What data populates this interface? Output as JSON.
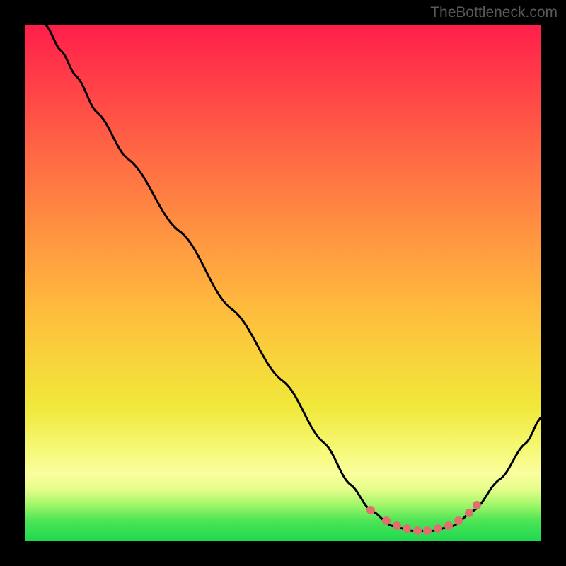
{
  "watermark": "TheBottleneck.com",
  "chart_data": {
    "type": "line",
    "title": "",
    "xlabel": "",
    "ylabel": "",
    "xlim": [
      0,
      100
    ],
    "ylim": [
      0,
      100
    ],
    "curve": {
      "name": "bottleneck-curve",
      "points": [
        {
          "x": 4,
          "y": 100
        },
        {
          "x": 7,
          "y": 95
        },
        {
          "x": 10,
          "y": 90
        },
        {
          "x": 14,
          "y": 83
        },
        {
          "x": 20,
          "y": 74
        },
        {
          "x": 30,
          "y": 60
        },
        {
          "x": 40,
          "y": 45
        },
        {
          "x": 50,
          "y": 31
        },
        {
          "x": 58,
          "y": 19
        },
        {
          "x": 63,
          "y": 11
        },
        {
          "x": 67,
          "y": 6
        },
        {
          "x": 71,
          "y": 3
        },
        {
          "x": 75,
          "y": 2
        },
        {
          "x": 79,
          "y": 2
        },
        {
          "x": 83,
          "y": 3
        },
        {
          "x": 87,
          "y": 6
        },
        {
          "x": 92,
          "y": 12
        },
        {
          "x": 97,
          "y": 19
        },
        {
          "x": 100,
          "y": 24
        }
      ]
    },
    "optimal_zone": {
      "name": "optimal-markers",
      "color": "#e26f6f",
      "points": [
        {
          "x": 67,
          "y": 6
        },
        {
          "x": 70,
          "y": 4
        },
        {
          "x": 72,
          "y": 3
        },
        {
          "x": 74,
          "y": 2.5
        },
        {
          "x": 76,
          "y": 2
        },
        {
          "x": 78,
          "y": 2
        },
        {
          "x": 80,
          "y": 2.5
        },
        {
          "x": 82,
          "y": 3
        },
        {
          "x": 84,
          "y": 4
        },
        {
          "x": 86,
          "y": 5.5
        },
        {
          "x": 87.5,
          "y": 7
        }
      ]
    },
    "background_gradient": {
      "top_color": "#ff1e4a",
      "mid_color": "#ffbb3d",
      "bottom_color": "#1ed84f"
    }
  }
}
